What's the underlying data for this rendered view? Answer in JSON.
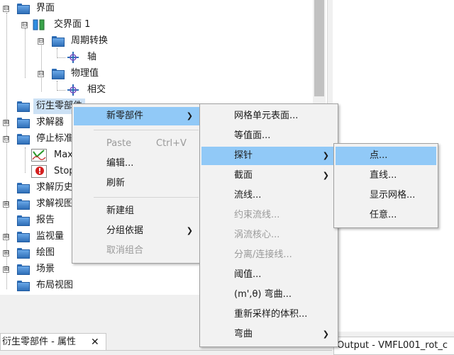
{
  "tree": {
    "items": [
      {
        "label": "界面",
        "expander": "⊟"
      },
      {
        "label": "交界面 1",
        "expander": "⊟"
      },
      {
        "label": "周期转换",
        "expander": "⊟"
      },
      {
        "label": "轴"
      },
      {
        "label": "物理值",
        "expander": "⊟"
      },
      {
        "label": "相交"
      },
      {
        "label": "衍生零部件"
      },
      {
        "label": "求解器",
        "expander": "⊞"
      },
      {
        "label": "停止标准",
        "expander": "⊟"
      },
      {
        "label": "Max"
      },
      {
        "label": "Stop"
      },
      {
        "label": "求解历史"
      },
      {
        "label": "求解视图",
        "expander": "⊞"
      },
      {
        "label": "报告"
      },
      {
        "label": "监视量",
        "expander": "⊞"
      },
      {
        "label": "绘图",
        "expander": "⊞"
      },
      {
        "label": "场景",
        "expander": "⊞"
      },
      {
        "label": "布局视图"
      }
    ]
  },
  "menu1": {
    "new_part": "新零部件",
    "paste": "Paste",
    "paste_shortcut": "Ctrl+V",
    "edit": "编辑...",
    "refresh": "刷新",
    "new_group": "新建组",
    "group_by": "分组依据",
    "ungroup": "取消组合"
  },
  "menu2": {
    "items": [
      "网格单元表面...",
      "等值面...",
      "探针",
      "截面",
      "流线...",
      "约束流线...",
      "涡流核心...",
      "分离/连接线...",
      "阈值...",
      "(m',θ) 弯曲...",
      "重新采样的体积...",
      "弯曲"
    ]
  },
  "menu3": {
    "items": [
      "点...",
      "直线...",
      "显示网格...",
      "任意..."
    ]
  },
  "tabs": {
    "properties": "衍生零部件 - 属性",
    "close": "✕",
    "output": "Output - VMFL001_rot_c"
  },
  "colors": {
    "highlight": "#91c9f7",
    "selected_row": "#cce1f5",
    "folder": "#2f6fb8"
  }
}
